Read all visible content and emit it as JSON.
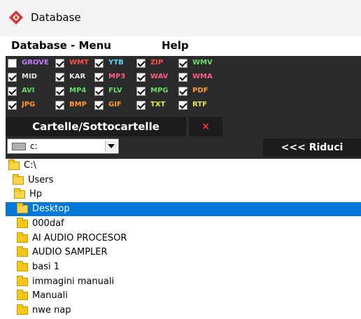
{
  "window": {
    "title": "Database"
  },
  "menubar": {
    "items": [
      "Database - Menu",
      "Help"
    ]
  },
  "colors": {
    "panel": "#2b2b2b",
    "selected": "#0078d7"
  },
  "filetypes": [
    [
      {
        "label": "GROVE",
        "checked": false,
        "color": "#c77dff"
      },
      {
        "label": "WMT",
        "checked": true,
        "color": "#ff4d4d"
      },
      {
        "label": "YTB",
        "checked": true,
        "color": "#5ad7ff"
      },
      {
        "label": "ZIP",
        "checked": true,
        "color": "#ff4d4d"
      },
      {
        "label": "WMV",
        "checked": true,
        "color": "#6bdc6b"
      }
    ],
    [
      {
        "label": "MID",
        "checked": true,
        "color": "#e6e6e6"
      },
      {
        "label": "KAR",
        "checked": true,
        "color": "#e6e6e6"
      },
      {
        "label": "MP3",
        "checked": true,
        "color": "#ff5c8a"
      },
      {
        "label": "WAV",
        "checked": true,
        "color": "#ff5c8a"
      },
      {
        "label": "WMA",
        "checked": true,
        "color": "#ff5c8a"
      }
    ],
    [
      {
        "label": "AVI",
        "checked": true,
        "color": "#6bdc6b"
      },
      {
        "label": "MP4",
        "checked": true,
        "color": "#6bdc6b"
      },
      {
        "label": "FLV",
        "checked": true,
        "color": "#6bdc6b"
      },
      {
        "label": "MPG",
        "checked": true,
        "color": "#6bdc6b"
      },
      {
        "label": "PDF",
        "checked": true,
        "color": "#ff9a2e"
      }
    ],
    [
      {
        "label": "JPG",
        "checked": true,
        "color": "#ff9a2e"
      },
      {
        "label": "BMP",
        "checked": true,
        "color": "#ff9a2e"
      },
      {
        "label": "GIF",
        "checked": true,
        "color": "#ff9a2e"
      },
      {
        "label": "TXT",
        "checked": true,
        "color": "#e8e84a"
      },
      {
        "label": "RTF",
        "checked": true,
        "color": "#e8e84a"
      }
    ]
  ],
  "buttons": {
    "cartelle": "Cartelle/Sottocartelle",
    "close": "×",
    "riduci": "<<< Riduci"
  },
  "drive": {
    "value": "c:"
  },
  "tree": [
    {
      "label": "C:\\",
      "level": 0,
      "open": true,
      "selected": false
    },
    {
      "label": "Users",
      "level": 1,
      "open": true,
      "selected": false
    },
    {
      "label": "Hp",
      "level": 2,
      "open": true,
      "selected": false
    },
    {
      "label": "Desktop",
      "level": 3,
      "open": true,
      "selected": true
    },
    {
      "label": "000daf",
      "level": 4,
      "open": false,
      "selected": false
    },
    {
      "label": "AI AUDIO PROCESOR",
      "level": 4,
      "open": false,
      "selected": false
    },
    {
      "label": "AUDIO SAMPLER",
      "level": 4,
      "open": false,
      "selected": false
    },
    {
      "label": "basi 1",
      "level": 4,
      "open": false,
      "selected": false
    },
    {
      "label": "immagini manuali",
      "level": 4,
      "open": false,
      "selected": false
    },
    {
      "label": "Manuali",
      "level": 4,
      "open": false,
      "selected": false
    },
    {
      "label": "nwe nap",
      "level": 4,
      "open": false,
      "selected": false
    }
  ]
}
